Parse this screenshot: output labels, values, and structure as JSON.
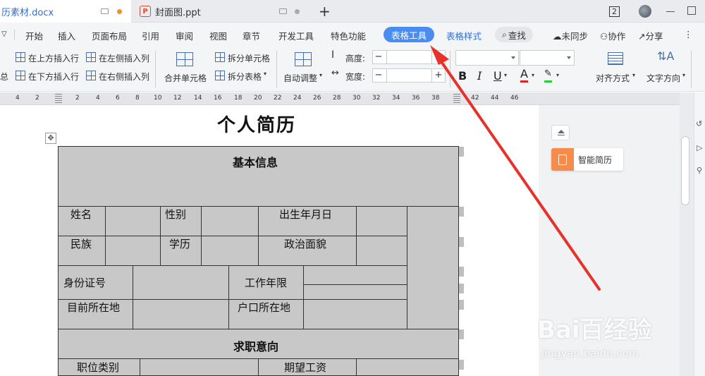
{
  "tabs": [
    {
      "label": "历素材.docx",
      "active": true
    },
    {
      "label": "封面图.ppt",
      "active": false
    }
  ],
  "window": {
    "badge": "2"
  },
  "menu": {
    "items": [
      "开始",
      "插入",
      "页面布局",
      "引用",
      "审阅",
      "视图",
      "章节",
      "开发工具",
      "特色功能"
    ],
    "active": "表格工具",
    "secondary": "表格样式",
    "search": "查找",
    "right": [
      "未同步",
      "协作",
      "分享"
    ]
  },
  "ribbon": {
    "insert_above": "在上方插入行",
    "insert_below": "在下方插入行",
    "insert_left": "在左侧插入列",
    "insert_right": "在右侧插入列",
    "merge": "合并单元格",
    "split_cell": "拆分单元格",
    "split_table": "拆分表格",
    "auto_fit": "自动调整",
    "height_label": "高度:",
    "width_label": "宽度:",
    "align": "对齐方式",
    "text_dir": "文字方向",
    "left_stub_1": "总"
  },
  "ruler": {
    "numbers": [
      "4",
      "2",
      "2",
      "4",
      "6",
      "8",
      "10",
      "12",
      "14",
      "16",
      "18",
      "20",
      "22",
      "24",
      "26",
      "28",
      "30",
      "32",
      "34",
      "36",
      "38",
      "42",
      "44",
      "46"
    ]
  },
  "document": {
    "title": "个人简历",
    "table": {
      "basic_info": "基本信息",
      "name": "姓名",
      "gender": "性别",
      "birth": "出生年月日",
      "ethnicity": "民族",
      "education": "学历",
      "politics": "政治面貌",
      "id_number": "身份证号",
      "work_years": "工作年限",
      "current_location": "目前所在地",
      "hukou": "户口所在地",
      "job_intent": "求职意向",
      "job_type": "职位类别",
      "expected_salary": "期望工资"
    }
  },
  "side_panel": {
    "smart_resume": "智能简历"
  },
  "watermark": {
    "main": "Bai百经验",
    "sub": "jingyan.baidu.com"
  },
  "colors": {
    "accent": "#4a8df0",
    "arrow": "#e8312a",
    "smart_resume": "#f58b4c"
  }
}
